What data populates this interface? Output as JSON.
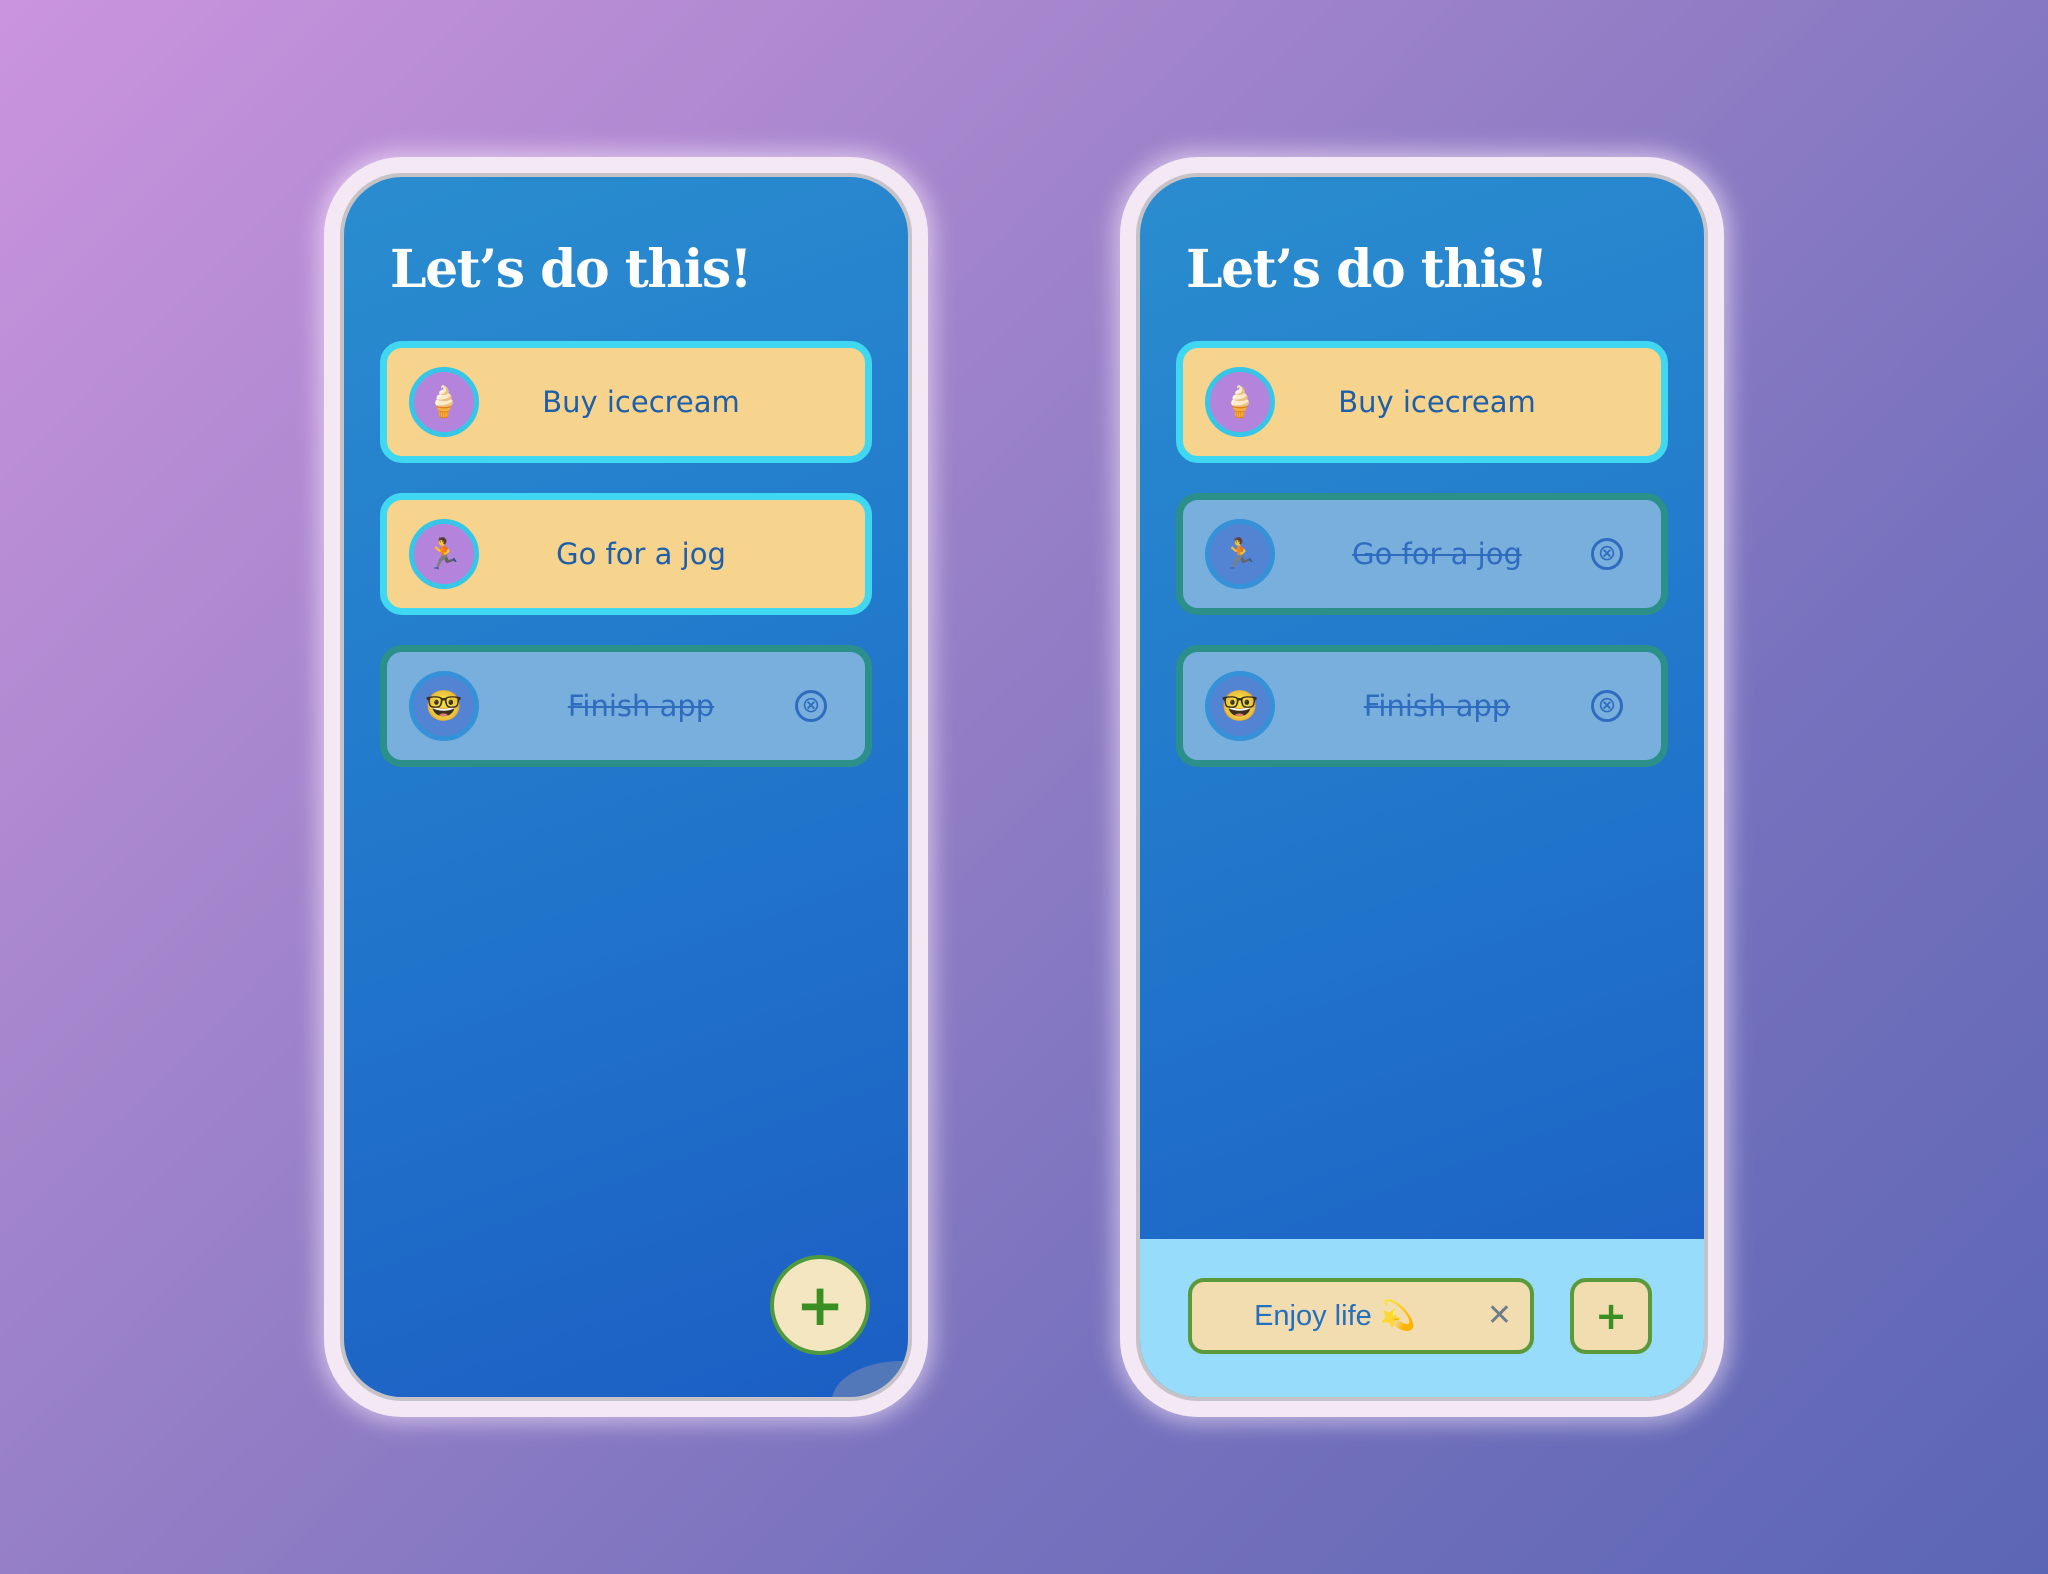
{
  "colors": {
    "background_start": "#cb94de",
    "background_end": "#5b66b4",
    "screen_blue": "#2177cb",
    "todo_card": "#f6d48e",
    "todo_border": "#3fd8f0",
    "done_card": "#79afdc",
    "done_border": "#2b8f8a",
    "add_green": "#3a8f22",
    "input_bar": "#97dcfa"
  },
  "screens": [
    {
      "title": "Let’s do this!",
      "tasks": [
        {
          "label": "Buy icecream",
          "emoji": "🍦",
          "done": false
        },
        {
          "label": "Go for a jog",
          "emoji": "🏃",
          "done": false
        },
        {
          "label": "Finish app",
          "emoji": "🤓",
          "done": true,
          "remove_icon": "⊗"
        }
      ],
      "fab": {
        "label": "+",
        "icon": "plus-icon"
      }
    },
    {
      "title": "Let’s do this!",
      "tasks": [
        {
          "label": "Buy icecream",
          "emoji": "🍦",
          "done": false
        },
        {
          "label": "Go for a jog",
          "emoji": "🏃",
          "done": true,
          "remove_icon": "⊗"
        },
        {
          "label": "Finish app",
          "emoji": "🤓",
          "done": true,
          "remove_icon": "⊗"
        }
      ],
      "input": {
        "value": "Enjoy life 💫",
        "clear_icon": "✕"
      },
      "add_button": {
        "label": "+"
      }
    }
  ]
}
